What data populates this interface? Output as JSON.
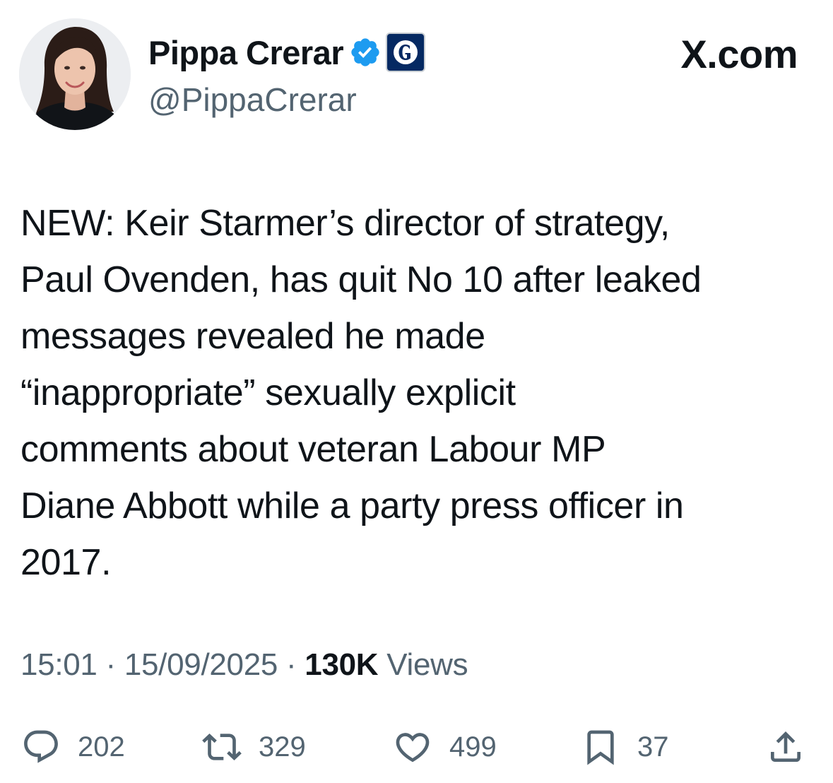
{
  "header": {
    "display_name": "Pippa Crerar",
    "handle": "@PippaCrerar",
    "brand": "X.com",
    "icons": {
      "verified": "verified-badge-icon",
      "affiliation": "guardian-logo-icon"
    },
    "colors": {
      "verified": "#1d9bf0",
      "affiliation_bg": "#052962"
    }
  },
  "tweet": {
    "text": "NEW: Keir Starmer’s director of strategy,\nPaul Ovenden, has quit No 10 after leaked\nmessages revealed he made\n“inappropriate” sexually explicit\ncomments about veteran Labour MP\nDiane Abbott while a party press officer in\n2017."
  },
  "meta": {
    "time": "15:01",
    "date": "15/09/2025",
    "separator": "·",
    "views_count": "130K",
    "views_label": "Views"
  },
  "actions": {
    "replies": "202",
    "reposts": "329",
    "likes": "499",
    "bookmarks": "37",
    "icons": [
      "reply-icon",
      "repost-icon",
      "like-icon",
      "bookmark-icon",
      "share-icon"
    ]
  }
}
